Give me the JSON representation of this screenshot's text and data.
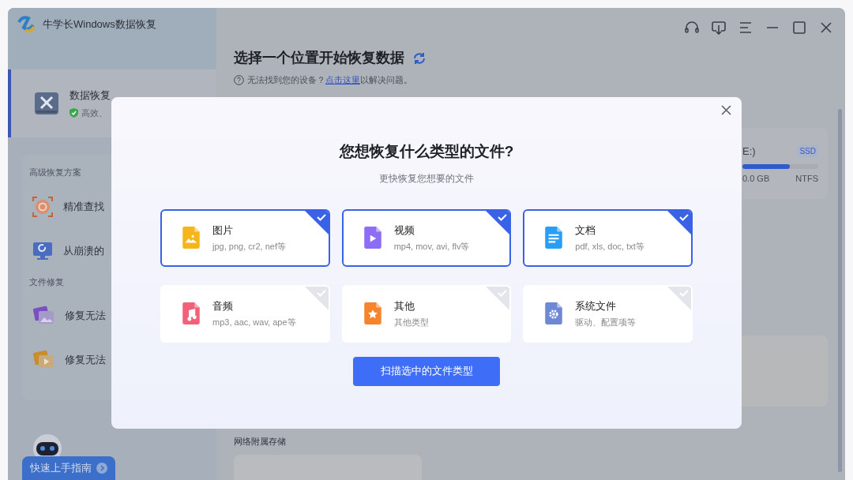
{
  "app": {
    "title": "牛学长Windows数据恢复"
  },
  "sidebar": {
    "main_item": {
      "label": "数据恢复",
      "subtitle": "高效、",
      "selected": true
    },
    "sections": [
      {
        "heading": "高级恢复方案",
        "items": [
          {
            "kind": "target",
            "label": "精准查找"
          },
          {
            "kind": "monitor",
            "label": "从崩溃的"
          }
        ]
      },
      {
        "heading": "文件修复",
        "items": [
          {
            "kind": "photo",
            "label": "修复无法"
          },
          {
            "kind": "video",
            "label": "修复无法"
          }
        ]
      }
    ],
    "guide_button": "快速上手指南"
  },
  "main": {
    "title": "选择一个位置开始恢复数据",
    "help": {
      "text": "无法找到您的设备？",
      "link": "点击这里",
      "suffix": "以解决问题。"
    },
    "drive": {
      "name": "E:)",
      "tag": "SSD",
      "level": 0.63,
      "size": "0.0 GB",
      "filesystem": "NTFS"
    },
    "nas_heading": "网络附属存储"
  },
  "dialog": {
    "title": "您想恢复什么类型的文件?",
    "subtitle": "更快恢复您想要的文件",
    "types": [
      {
        "kind": "image",
        "name": "图片",
        "exts": "jpg, png, cr2, nef等",
        "selected": true
      },
      {
        "kind": "video",
        "name": "视频",
        "exts": "mp4, mov, avi, flv等",
        "selected": true
      },
      {
        "kind": "document",
        "name": "文档",
        "exts": "pdf, xls, doc, txt等",
        "selected": true
      },
      {
        "kind": "audio",
        "name": "音频",
        "exts": "mp3, aac, wav, ape等",
        "selected": false
      },
      {
        "kind": "other",
        "name": "其他",
        "exts": "其他类型",
        "selected": false
      },
      {
        "kind": "system",
        "name": "系统文件",
        "exts": "驱动、配置项等",
        "selected": false
      }
    ],
    "scan_button": "扫描选中的文件类型"
  }
}
